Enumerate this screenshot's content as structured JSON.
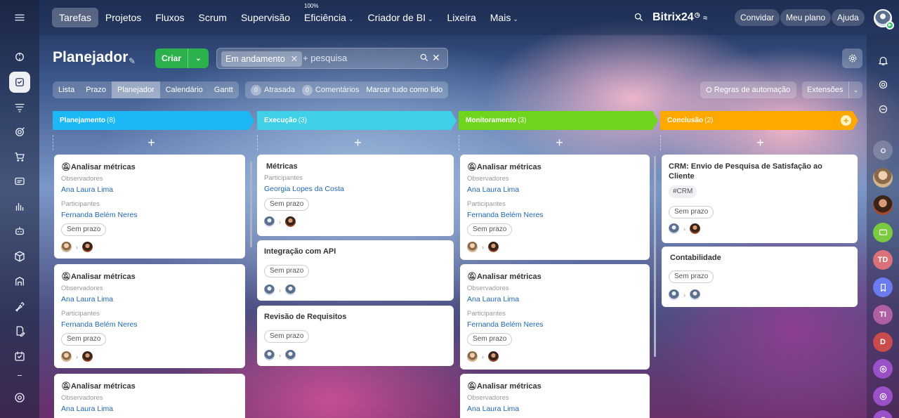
{
  "topbar": {
    "nav": [
      {
        "label": "Tarefas",
        "active": true
      },
      {
        "label": "Projetos"
      },
      {
        "label": "Fluxos"
      },
      {
        "label": "Scrum"
      },
      {
        "label": "Supervisão"
      },
      {
        "label": "Eficiência",
        "badge": "100%",
        "dropdown": true
      },
      {
        "label": "Criador de BI",
        "dropdown": true
      },
      {
        "label": "Lixeira"
      },
      {
        "label": "Mais",
        "dropdown": true
      }
    ],
    "brand": "Bitrix24",
    "brand_suffix": "24",
    "invite_label": "Convidar",
    "plan_label": "Meu plano",
    "help_label": "Ajuda"
  },
  "page": {
    "title": "Planejador",
    "create_label": "Criar",
    "filter_chip": "Em andamento",
    "search_placeholder": "+ pesquisa",
    "views": [
      "Lista",
      "Prazo",
      "Planejador",
      "Calendário",
      "Gantt"
    ],
    "active_view": "Planejador",
    "counters": [
      {
        "n": "0",
        "label": "Atrasada"
      },
      {
        "n": "0",
        "label": "Comentários"
      }
    ],
    "mark_all_label": "Marcar tudo como lido",
    "automation_label": "Regras de automação",
    "extensions_label": "Extensões"
  },
  "columns": [
    {
      "title": "Planejamento",
      "count": "(8)",
      "color": "#1cb8f5"
    },
    {
      "title": "Execução",
      "count": "(3)",
      "color": "#3fcfe6"
    },
    {
      "title": "Monitoramento",
      "count": "(3)",
      "color": "#6fd41c"
    },
    {
      "title": "Conclusão",
      "count": "(2)",
      "color": "#ffa900"
    }
  ],
  "labels": {
    "observers": "Observadores",
    "participants": "Participantes",
    "no_deadline": "Sem prazo"
  },
  "cards": {
    "metric_title": "Analisar métricas",
    "observer": "Ana Laura Lima",
    "participant": "Fernanda Belém Neres",
    "exec_1_title": "Métricas",
    "exec_1_participant": "Georgia Lopes da Costa",
    "exec_2_title": "Integração com API",
    "exec_3_title": "Revisão de Requisitos",
    "done_1_title": "CRM: Envio de Pesquisa de Satisfação ao Cliente",
    "done_1_tag": "#CRM",
    "done_2_title": "Contabilidade"
  },
  "right_sidebar": {
    "initials_1": "TD",
    "initials_2": "TI",
    "initials_3": "D"
  },
  "colors": {
    "accent_green": "#2bb24c",
    "link": "#2067b0"
  }
}
